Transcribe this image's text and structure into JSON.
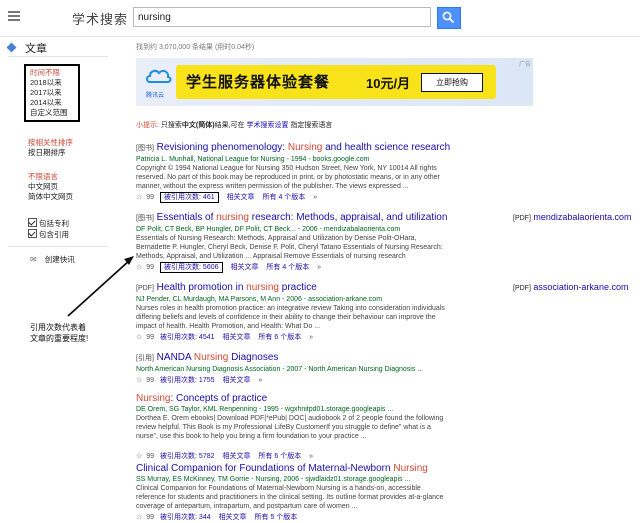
{
  "header": {
    "logo": "学术搜索",
    "search_value": "nursing"
  },
  "sidebar": {
    "title": "文章",
    "time_filters": [
      "时间不限",
      "2018以来",
      "2017以来",
      "2014以来",
      "自定义范围"
    ],
    "sort": [
      "按相关性排序",
      "按日期排序"
    ],
    "lang": [
      "不限语言",
      "中文网页",
      "简体中文网页"
    ],
    "checks": [
      "包括专利",
      "包含引用"
    ],
    "alert": "创建快讯"
  },
  "annotation": {
    "line1": "引用次数代表着",
    "line2": "文章的重要程度!"
  },
  "stats": "找到约 3,070,000 条结果  (用时0.04秒)",
  "ad": {
    "brand": "腾讯云",
    "headline": "学生服务器体验套餐",
    "price": "10元/月",
    "cta": "立即抢购",
    "ad_mark": "广告"
  },
  "tip": {
    "label": "小提示:",
    "text1": "只搜索",
    "bold": "中文(简体)",
    "text2": "结果,可在",
    "link": "学术搜索设置",
    "text3": "指定搜索语言"
  },
  "results": [
    {
      "tag": "[图书]",
      "title_a": "Revisioning phenomenology: ",
      "title_hl": "Nursing",
      "title_b": " and health science research",
      "authors": "Patricia L. Munhall, National League for Nursing - 1994 - books.google.com",
      "snippet": "Copyright © 1994 National League for Nursing 350 Hudson Street, New York, NY 10014 All rights reserved. No part of this book may be reproduced in print, or by photostatic means, or in any other manner, without the express written permission of the publisher. The views expressed ...",
      "cited": "被引用次数: 461",
      "related": "相关文章",
      "versions": "所有 4 个版本"
    },
    {
      "tag": "[图书]",
      "title_a": "Essentials of ",
      "title_hl": "nursing",
      "title_b": " research: Methods, appraisal, and utilization",
      "authors": "DF Polit, CT Beck, BP Hungler, DF Polit, CT Beck... - 2006 - mendizabalaorienta.com",
      "snippet": "Essentials of Nursing Research: Methods, Appraisal and Utilization by Denise Polit-OHara, Bernadette P. Hungler, Cheryl Beck, Denise F. Polit, Cheryl Tatano Essentials of Nursing Research: Methods, Appraisal, and Utilization ... Appraisal Remove Essentials of nursing research",
      "cited": "被引用次数: 5606",
      "related": "相关文章",
      "versions": "所有 4 个版本",
      "pdf_tag": "[PDF]",
      "pdf_source": "mendizabalaorienta.com"
    },
    {
      "tag": "[PDF]",
      "title_a": "Health promotion in ",
      "title_hl": "nursing",
      "title_b": " practice",
      "authors": "NJ Pender, CL Murdaugh, MA Parsons, M Ann - 2006 - association-arkane.com",
      "snippet": "Nurses roles in health promotion practice: an integrative review Taking into consideration individuals differing beliefs and levels of confidence in their ability to change their behaviour can improve the impact of health. Health Promotion, and Health: What Do ...",
      "cited": "被引用次数: 4541",
      "related": "相关文章",
      "versions": "所有 6 个版本",
      "pdf_tag": "[PDF]",
      "pdf_source": "association-arkane.com"
    },
    {
      "tag": "[引用]",
      "title_a": "NANDA ",
      "title_hl": "Nursing",
      "title_b": " Diagnoses",
      "authors": "North American Nursing Diagnosis Association - 2007 - North American Nursing Diagnosis ...",
      "snippet": "",
      "cited": "被引用次数: 1755",
      "related": "相关文章",
      "versions": ""
    },
    {
      "tag": "",
      "title_a": "",
      "title_hl": "Nursing",
      "title_b": ": Concepts of practice",
      "authors": "DE Orem, SG Taylor, KML Renpenning - 1995 - wgxhnitpd01.storage.googleapis ...",
      "snippet": "Dorthea E. Orem ebooks| Download PDF|*ePub| DOC| audiobook 2 of 2 people found the following review helpful. This Book is my Professional LifeBy CustomerIf you struggle to define\" what is a nurse\", use this book to help you bring a firm foundation to your practice ...",
      "cited": "被引用次数: 5782",
      "related": "相关文章",
      "versions": "所有 6 个版本"
    },
    {
      "tag": "",
      "title_a": "Clinical Companion for Foundations of Maternal-Newborn ",
      "title_hl": "Nursing",
      "title_b": "",
      "authors": "SS Murray, ES McKinney, TM Gorrie - Nursing, 2006 - sjwdlaidz01.storage.googleapis ...",
      "snippet": "Clinical Companion for Foundations of Maternal-Newborn Nursing is a hands-on, accessible reference for students and practitioners in the clinical setting. Its outline format provides at-a-glance coverage of antepartum, intrapartum, and postpartum care of women ...",
      "cited": "被引用次数: 344",
      "related": "相关文章",
      "versions": "所有 5 个版本"
    }
  ]
}
